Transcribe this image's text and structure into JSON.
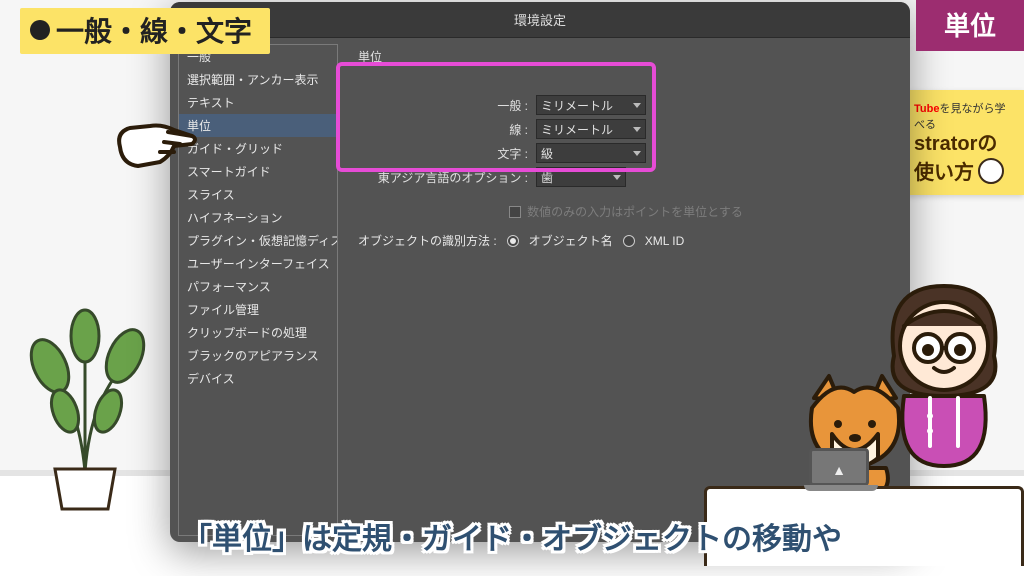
{
  "topic": "一般・線・文字",
  "right_badge": "単位",
  "promo": {
    "line1_prefix": "Tube",
    "line1_suffix": "を見ながら学べる",
    "line2": "stratorの",
    "line3": "使い方"
  },
  "dialog": {
    "title": "環境設定",
    "panel_title": "単位",
    "sidebar": [
      "一般",
      "選択範囲・アンカー表示",
      "テキスト",
      "単位",
      "ガイド・グリッド",
      "スマートガイド",
      "スライス",
      "ハイフネーション",
      "プラグイン・仮想記憶ディスク",
      "ユーザーインターフェイス",
      "パフォーマンス",
      "ファイル管理",
      "クリップボードの処理",
      "ブラックのアピアランス",
      "デバイス"
    ],
    "selected_index": 3,
    "rows": {
      "general": {
        "label": "一般 :",
        "value": "ミリメートル"
      },
      "stroke": {
        "label": "線 :",
        "value": "ミリメートル"
      },
      "type": {
        "label": "文字 :",
        "value": "級"
      },
      "east": {
        "label": "東アジア言語のオプション :",
        "value": "歯"
      }
    },
    "numbers_note": "数値のみの入力はポイントを単位とする",
    "id_label": "オブジェクトの識別方法 :",
    "id_opt1": "オブジェクト名",
    "id_opt2": "XML ID"
  },
  "subtitle": "「単位」は定規・ガイド・オブジェクトの移動や"
}
